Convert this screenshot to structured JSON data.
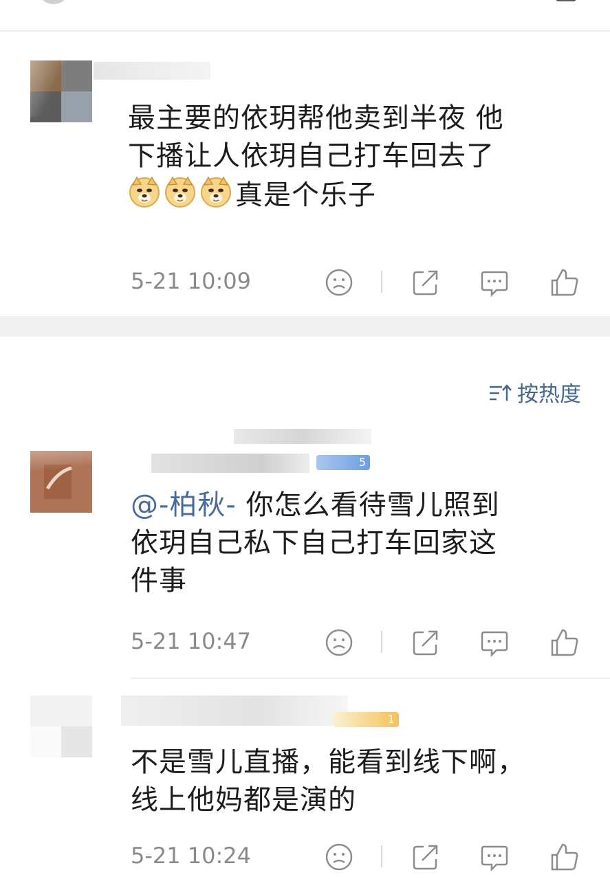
{
  "header": {
    "title": "按热度"
  },
  "comments": [
    {
      "text_lines": [
        "最主要的依玥帮他卖到半夜  他",
        "下播让人依玥自己打车回去了"
      ],
      "emoji_count": 3,
      "emoji_name": "doge-emoji",
      "text_after_emoji": "真是个乐子",
      "time": "5-21 10:09"
    }
  ],
  "sort": {
    "label": "按热度",
    "icon": "sort-icon"
  },
  "replies": [
    {
      "level_badge": "5",
      "mention": "@-柏秋-",
      "text_lines_first_rest": " 你怎么看待雪儿照到",
      "text_lines": [
        "依玥自己私下自己打车回家这",
        "件事"
      ],
      "time": "5-21 10:47"
    },
    {
      "level_badge": "1",
      "text_lines": [
        "不是雪儿直播，能看到线下啊，",
        "线上他妈都是演的"
      ],
      "time": "5-21 10:24"
    }
  ],
  "actions": {
    "dislike_icon": "frown-icon",
    "share_icon": "share-icon",
    "reply_icon": "comment-icon",
    "like_icon": "thumbs-up-icon"
  },
  "colors": {
    "link": "#496a9a",
    "time": "#8a8a8a",
    "badge_blue": "#6d9fe0",
    "badge_gold": "#f3c25a",
    "section_gap": "#f1f1f1"
  }
}
